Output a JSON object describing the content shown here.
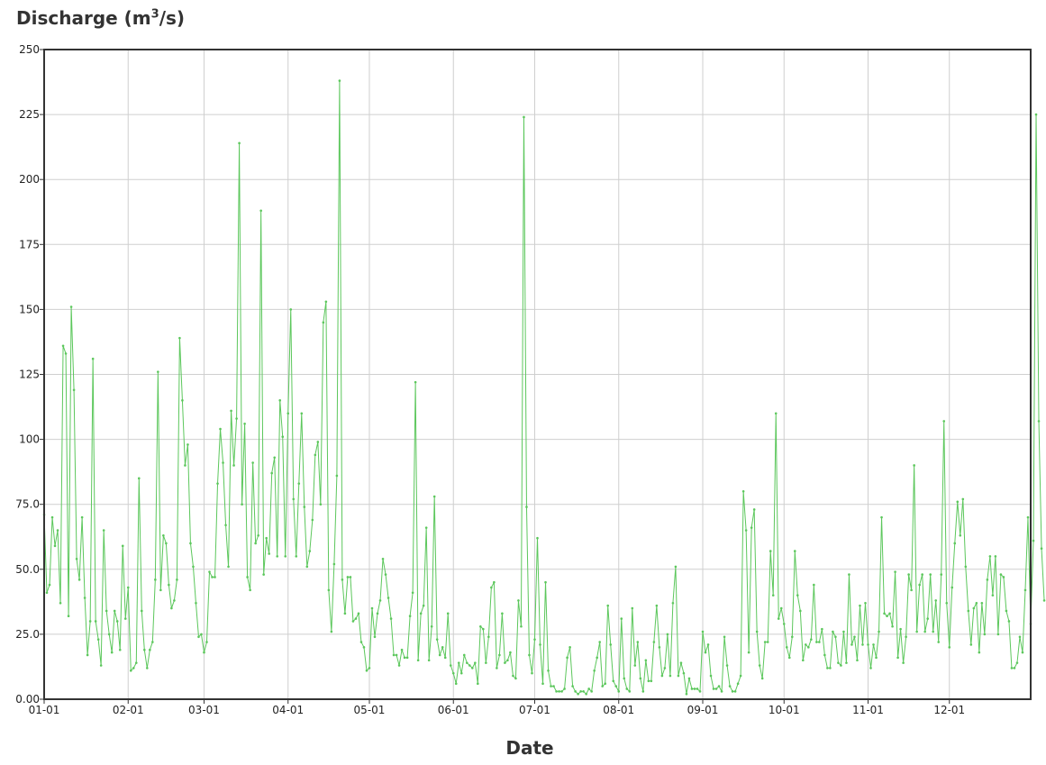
{
  "chart_data": {
    "type": "line",
    "title": "",
    "ylabel": {
      "prefix": "Discharge (m",
      "sup": "3",
      "suffix": "/s)"
    },
    "xlabel": "Date",
    "ylim": [
      0,
      250
    ],
    "xlim": [
      0,
      364
    ],
    "grid": true,
    "line_color": "#5cc75c",
    "y_ticks": [
      {
        "value": 0,
        "label": "0.00"
      },
      {
        "value": 25,
        "label": "25.0"
      },
      {
        "value": 50,
        "label": "50.0"
      },
      {
        "value": 75,
        "label": "75.0"
      },
      {
        "value": 100,
        "label": "100"
      },
      {
        "value": 125,
        "label": "125"
      },
      {
        "value": 150,
        "label": "150"
      },
      {
        "value": 175,
        "label": "175"
      },
      {
        "value": 200,
        "label": "200"
      },
      {
        "value": 225,
        "label": "225"
      },
      {
        "value": 250,
        "label": "250"
      }
    ],
    "x_ticks": [
      {
        "day": 0,
        "label": "01-01"
      },
      {
        "day": 31,
        "label": "02-01"
      },
      {
        "day": 59,
        "label": "03-01"
      },
      {
        "day": 90,
        "label": "04-01"
      },
      {
        "day": 120,
        "label": "05-01"
      },
      {
        "day": 151,
        "label": "06-01"
      },
      {
        "day": 181,
        "label": "07-01"
      },
      {
        "day": 212,
        "label": "08-01"
      },
      {
        "day": 243,
        "label": "09-01"
      },
      {
        "day": 273,
        "label": "10-01"
      },
      {
        "day": 304,
        "label": "11-01"
      },
      {
        "day": 334,
        "label": "12-01"
      }
    ],
    "series": [
      {
        "values": [
          71,
          41,
          44,
          70,
          59,
          65,
          37,
          136,
          133,
          32,
          151,
          119,
          54,
          46,
          70,
          39,
          17,
          30,
          131,
          30,
          23,
          13,
          65,
          34,
          25,
          18,
          34,
          30,
          19,
          59,
          31,
          43,
          11,
          12,
          14,
          85,
          34,
          19,
          12,
          19,
          22,
          46,
          126,
          42,
          63,
          60,
          44,
          35,
          38,
          46,
          139,
          115,
          90,
          98,
          60,
          51,
          37,
          24,
          25,
          18,
          22,
          49,
          47,
          47,
          83,
          104,
          91,
          67,
          51,
          111,
          90,
          108,
          214,
          75,
          106,
          47,
          42,
          91,
          60,
          63,
          188,
          48,
          62,
          56,
          87,
          93,
          55,
          115,
          101,
          55,
          110,
          150,
          77,
          55,
          83,
          110,
          74,
          51,
          57,
          69,
          94,
          99,
          75,
          145,
          153,
          42,
          26,
          52,
          86,
          238,
          46,
          33,
          47,
          47,
          30,
          31,
          33,
          22,
          20,
          11,
          12,
          35,
          24,
          33,
          38,
          54,
          48,
          39,
          31,
          17,
          17,
          13,
          19,
          16,
          16,
          32,
          41,
          122,
          15,
          33,
          36,
          66,
          15,
          28,
          78,
          23,
          17,
          20,
          16,
          33,
          13,
          10,
          6,
          14,
          10,
          17,
          14,
          13,
          12,
          14,
          6,
          28,
          27,
          14,
          24,
          43,
          45,
          12,
          17,
          33,
          14,
          15,
          18,
          9,
          8,
          38,
          28,
          224,
          74,
          17,
          10,
          23,
          62,
          21,
          6,
          45,
          11,
          5,
          5,
          3,
          3,
          3,
          4,
          16,
          20,
          5,
          3,
          2,
          3,
          3,
          2,
          4,
          3,
          11,
          16,
          22,
          5,
          6,
          36,
          21,
          7,
          5,
          3,
          31,
          8,
          4,
          3,
          35,
          13,
          22,
          8,
          3,
          15,
          7,
          7,
          22,
          36,
          20,
          9,
          12,
          25,
          9,
          37,
          51,
          9,
          14,
          10,
          2,
          8,
          4,
          4,
          4,
          3,
          26,
          18,
          21,
          9,
          4,
          4,
          5,
          3,
          24,
          13,
          5,
          3,
          3,
          6,
          9,
          80,
          65,
          18,
          66,
          73,
          26,
          13,
          8,
          22,
          22,
          57,
          40,
          110,
          31,
          35,
          29,
          20,
          16,
          24,
          57,
          40,
          34,
          15,
          21,
          20,
          23,
          44,
          22,
          22,
          27,
          17,
          12,
          12,
          26,
          24,
          14,
          13,
          26,
          14,
          48,
          21,
          24,
          15,
          36,
          21,
          37,
          21,
          12,
          21,
          16,
          26,
          70,
          33,
          32,
          33,
          28,
          49,
          16,
          27,
          14,
          24,
          48,
          42,
          90,
          26,
          44,
          48,
          26,
          31,
          48,
          26,
          38,
          22,
          48,
          107,
          37,
          20,
          43,
          60,
          76,
          63,
          77,
          51,
          34,
          21,
          35,
          37,
          18,
          37,
          25,
          46,
          55,
          40,
          55,
          25,
          48,
          47,
          34,
          30,
          12,
          12,
          14,
          24,
          18,
          42,
          70,
          29,
          61,
          225,
          107,
          58,
          38
        ]
      }
    ]
  }
}
